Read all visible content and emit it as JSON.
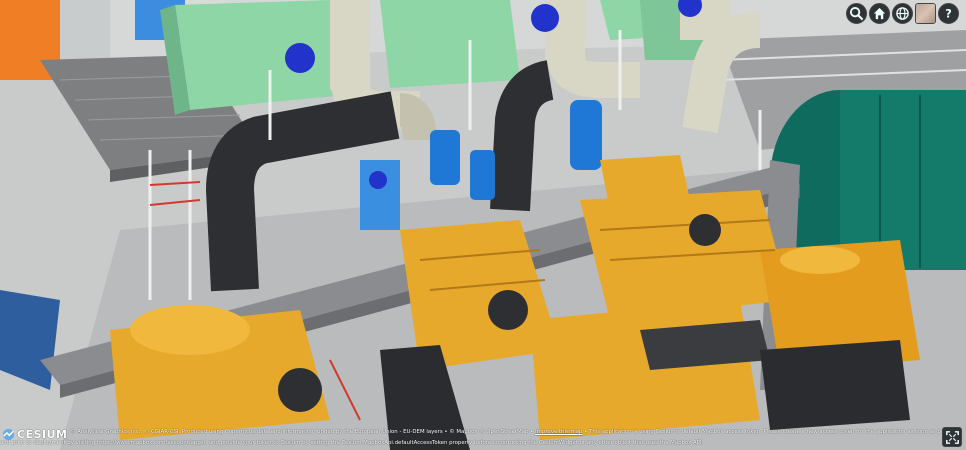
{
  "viewer": {
    "toolbar": [
      {
        "name": "geocoder-search-icon"
      },
      {
        "name": "home-icon"
      },
      {
        "name": "scene-mode-globe-icon"
      },
      {
        "name": "base-layer-picker-thumbnail"
      },
      {
        "name": "help-question-icon"
      }
    ],
    "credits": {
      "logo_text": "CESIUM",
      "line1": "© Analytical Graphics Inc., © CGIAR-CSI, Produced using Copernicus data and information funded by the European Union - EU-DEM layers • © Mapbox © OpenStreetMap •",
      "improve_link": "Improve this map",
      "line1_tail": "• This application is using Cesium's default Mapbox access token. Please create a new access token for the application as soon as p",
      "line2": "and prior to deployment by visiting https://www.mapbox.com/account/apps/, and provide your token to Cesium by setting the Cesium.MapboxApi.defaultAccessToken property before constructing the CesiumWidget or any other object that uses the Mapbox API."
    },
    "colors": {
      "machinery_yellow": "#e7a92b",
      "duct_green": "#8fd6a6",
      "pipe_black": "#2d2f33",
      "pipe_beige": "#d8d6c4",
      "tank_blue": "#1f78d6",
      "valve_blue": "#2233cc",
      "cylinder_teal": "#147a6a",
      "beam_gray": "#8a8c8f",
      "toolbar_bg": "#303336"
    }
  }
}
